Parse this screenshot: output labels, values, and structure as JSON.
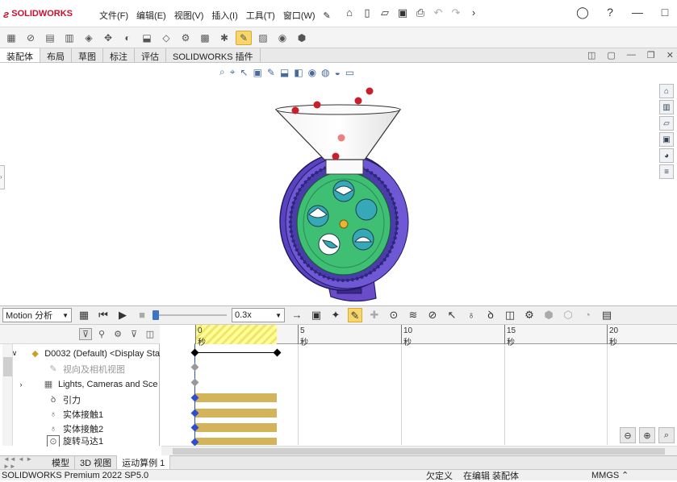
{
  "app": {
    "logo_text": "SOLIDWORKS",
    "menu": [
      "文件(F)",
      "编辑(E)",
      "视图(V)",
      "插入(I)",
      "工具(T)",
      "窗口(W)"
    ]
  },
  "tabs": [
    "装配体",
    "布局",
    "草图",
    "标注",
    "评估",
    "SOLIDWORKS 插件"
  ],
  "motion": {
    "study_type": "Motion 分析",
    "speed": "0.3x"
  },
  "tree": {
    "items": [
      {
        "label": "D0032 (Default) <Display Sta",
        "icon": "assembly-icon",
        "muted": false
      },
      {
        "label": "视向及相机视图",
        "icon": "camera-icon",
        "muted": true
      },
      {
        "label": "Lights, Cameras and Sce",
        "icon": "lights-folder-icon",
        "muted": false
      },
      {
        "label": "引力",
        "icon": "gravity-icon",
        "muted": false
      },
      {
        "label": "实体接触1",
        "icon": "contact-icon",
        "muted": false
      },
      {
        "label": "实体接触2",
        "icon": "contact-icon",
        "muted": false
      },
      {
        "label": "旋转马达1",
        "icon": "motor-icon",
        "muted": false
      }
    ]
  },
  "timeline": {
    "ticks": [
      "0 秒",
      "5 秒",
      "10 秒",
      "15 秒",
      "20 秒"
    ]
  },
  "bottom_tabs": [
    "模型",
    "3D 视图",
    "运动算例 1"
  ],
  "status": {
    "product": "SOLIDWORKS Premium 2022 SP5.0",
    "defined": "欠定义",
    "editing": "在编辑 装配体",
    "units": "MMGS"
  }
}
